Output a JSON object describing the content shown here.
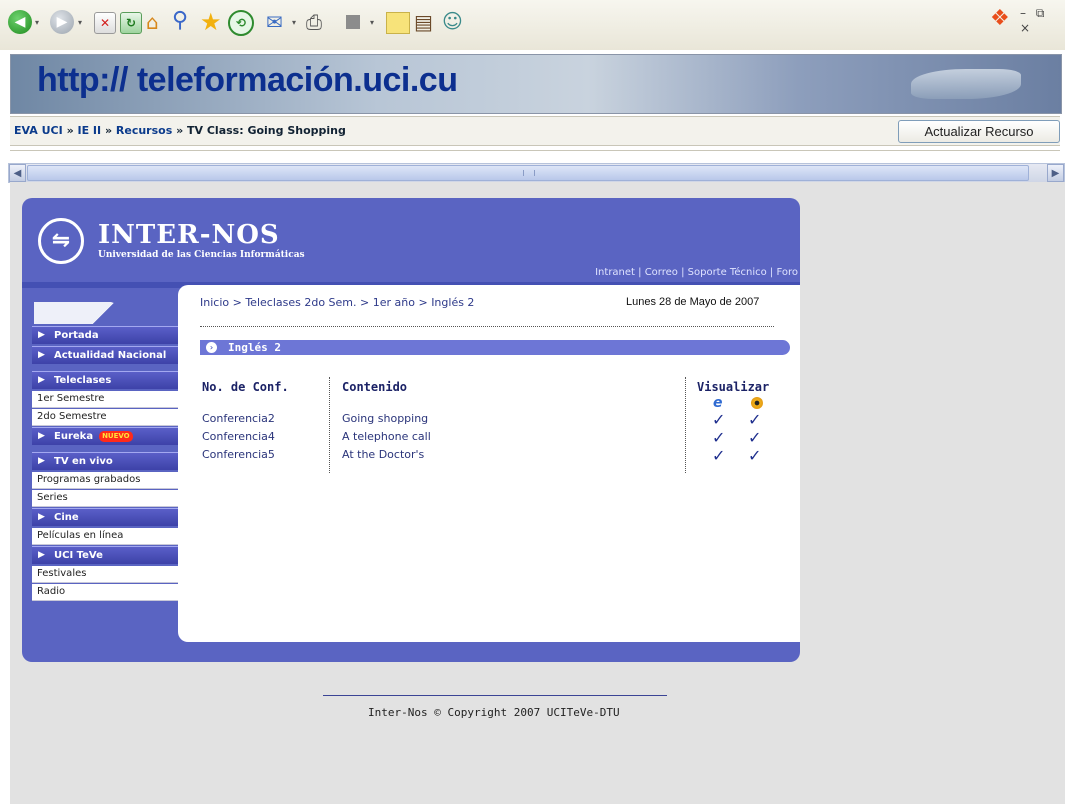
{
  "toolbar": {
    "arrow_glyph": "▾",
    "window_controls": "– ⧉ ×"
  },
  "header": {
    "url_banner": "http:// teleformación.uci.cu"
  },
  "navbar": {
    "breadcrumb": [
      {
        "label": "EVA UCI",
        "link": true
      },
      {
        "label": "IE II",
        "link": true
      },
      {
        "label": "Recursos",
        "link": true
      },
      {
        "label": "TV Class: Going Shopping",
        "link": false
      }
    ],
    "separator": " » ",
    "update_button": "Actualizar Recurso"
  },
  "site": {
    "title": "INTER-NOS",
    "subtitle": "Universidad de las Ciencias Informáticas",
    "header_links": [
      "Intranet",
      "Correo",
      "Soporte Técnico",
      "Foro"
    ]
  },
  "sidebar": {
    "items": [
      {
        "label": "Portada",
        "type": "head"
      },
      {
        "label": "Actualidad Nacional",
        "type": "head"
      },
      {
        "type": "gap"
      },
      {
        "label": "Teleclases",
        "type": "head"
      },
      {
        "label": "1er Semestre",
        "type": "sub"
      },
      {
        "label": "2do Semestre",
        "type": "sub"
      },
      {
        "label": "Eureka",
        "type": "head",
        "badge": "NUEVO"
      },
      {
        "type": "gap"
      },
      {
        "label": "TV en vivo",
        "type": "head"
      },
      {
        "label": "Programas grabados",
        "type": "sub"
      },
      {
        "label": "Series",
        "type": "sub"
      },
      {
        "label": "Cine",
        "type": "head"
      },
      {
        "label": "Películas en línea",
        "type": "sub"
      },
      {
        "label": "UCI TeVe",
        "type": "head"
      },
      {
        "label": "Festivales",
        "type": "sub"
      },
      {
        "label": "Radio",
        "type": "sub"
      }
    ]
  },
  "content": {
    "crumbs": [
      "Inicio",
      "Teleclases 2do Sem.",
      "1er año",
      "Inglés 2"
    ],
    "crumb_sep": " > ",
    "date": "Lunes 28 de Mayo de 2007",
    "section_title": "Inglés 2",
    "columns": {
      "conf": "No. de Conf.",
      "content": "Contenido",
      "view": "Visualizar"
    },
    "rows": [
      {
        "conf": "Conferencia2",
        "content": "Going shopping"
      },
      {
        "conf": "Conferencia4",
        "content": "A telephone call"
      },
      {
        "conf": "Conferencia5",
        "content": "At the Doctor's"
      }
    ],
    "check_glyph": "✓",
    "footer": "Inter-Nos © Copyright 2007 UCITeVe-DTU"
  },
  "colors": {
    "panel": "#5a64c2",
    "menu_head": "#3d42a8",
    "link": "#0b3b8c",
    "badge": "#ff2a1a"
  },
  "icons": [
    "back-icon",
    "forward-icon",
    "stop-icon",
    "refresh-icon",
    "home-icon",
    "search-icon",
    "favorites-icon",
    "history-icon",
    "mail-icon",
    "print-icon",
    "edit-icon",
    "note-icon",
    "research-icon",
    "messenger-icon",
    "windows-logo-icon",
    "ie-icon",
    "media-player-icon",
    "check-icon"
  ]
}
